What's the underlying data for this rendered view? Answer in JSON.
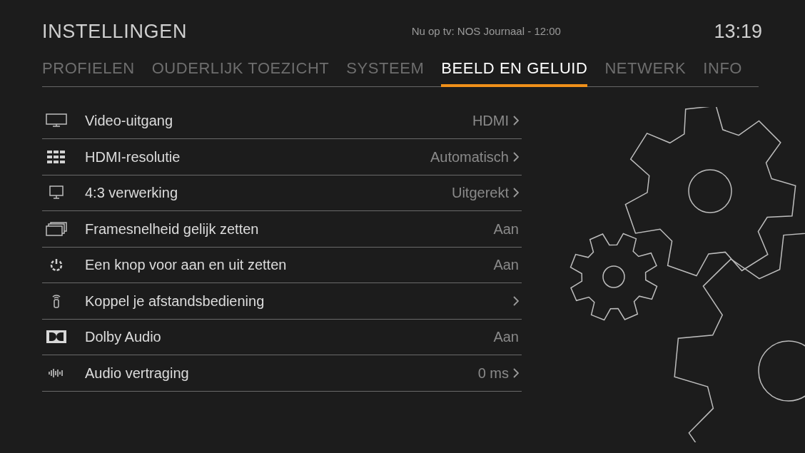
{
  "header": {
    "title": "INSTELLINGEN",
    "now_playing": "Nu op tv: NOS Journaal - 12:00",
    "clock": "13:19"
  },
  "tabs": [
    {
      "label": "PROFIELEN",
      "selected": false
    },
    {
      "label": "OUDERLIJK TOEZICHT",
      "selected": false
    },
    {
      "label": "SYSTEEM",
      "selected": false
    },
    {
      "label": "BEELD EN GELUID",
      "selected": true
    },
    {
      "label": "NETWERK",
      "selected": false
    },
    {
      "label": "INFO",
      "selected": false
    }
  ],
  "settings": [
    {
      "label": "Video-uitgang",
      "value": "HDMI",
      "submenu": true
    },
    {
      "label": "HDMI-resolutie",
      "value": "Automatisch",
      "submenu": true
    },
    {
      "label": "4:3 verwerking",
      "value": "Uitgerekt",
      "submenu": true
    },
    {
      "label": "Framesnelheid gelijk zetten",
      "value": "Aan",
      "submenu": false
    },
    {
      "label": "Een knop voor aan en uit zetten",
      "value": "Aan",
      "submenu": false
    },
    {
      "label": "Koppel je afstandsbediening",
      "submenu": true
    },
    {
      "label": "Dolby Audio",
      "value": "Aan",
      "submenu": false
    },
    {
      "label": "Audio vertraging",
      "value": "0 ms",
      "submenu": true
    }
  ]
}
